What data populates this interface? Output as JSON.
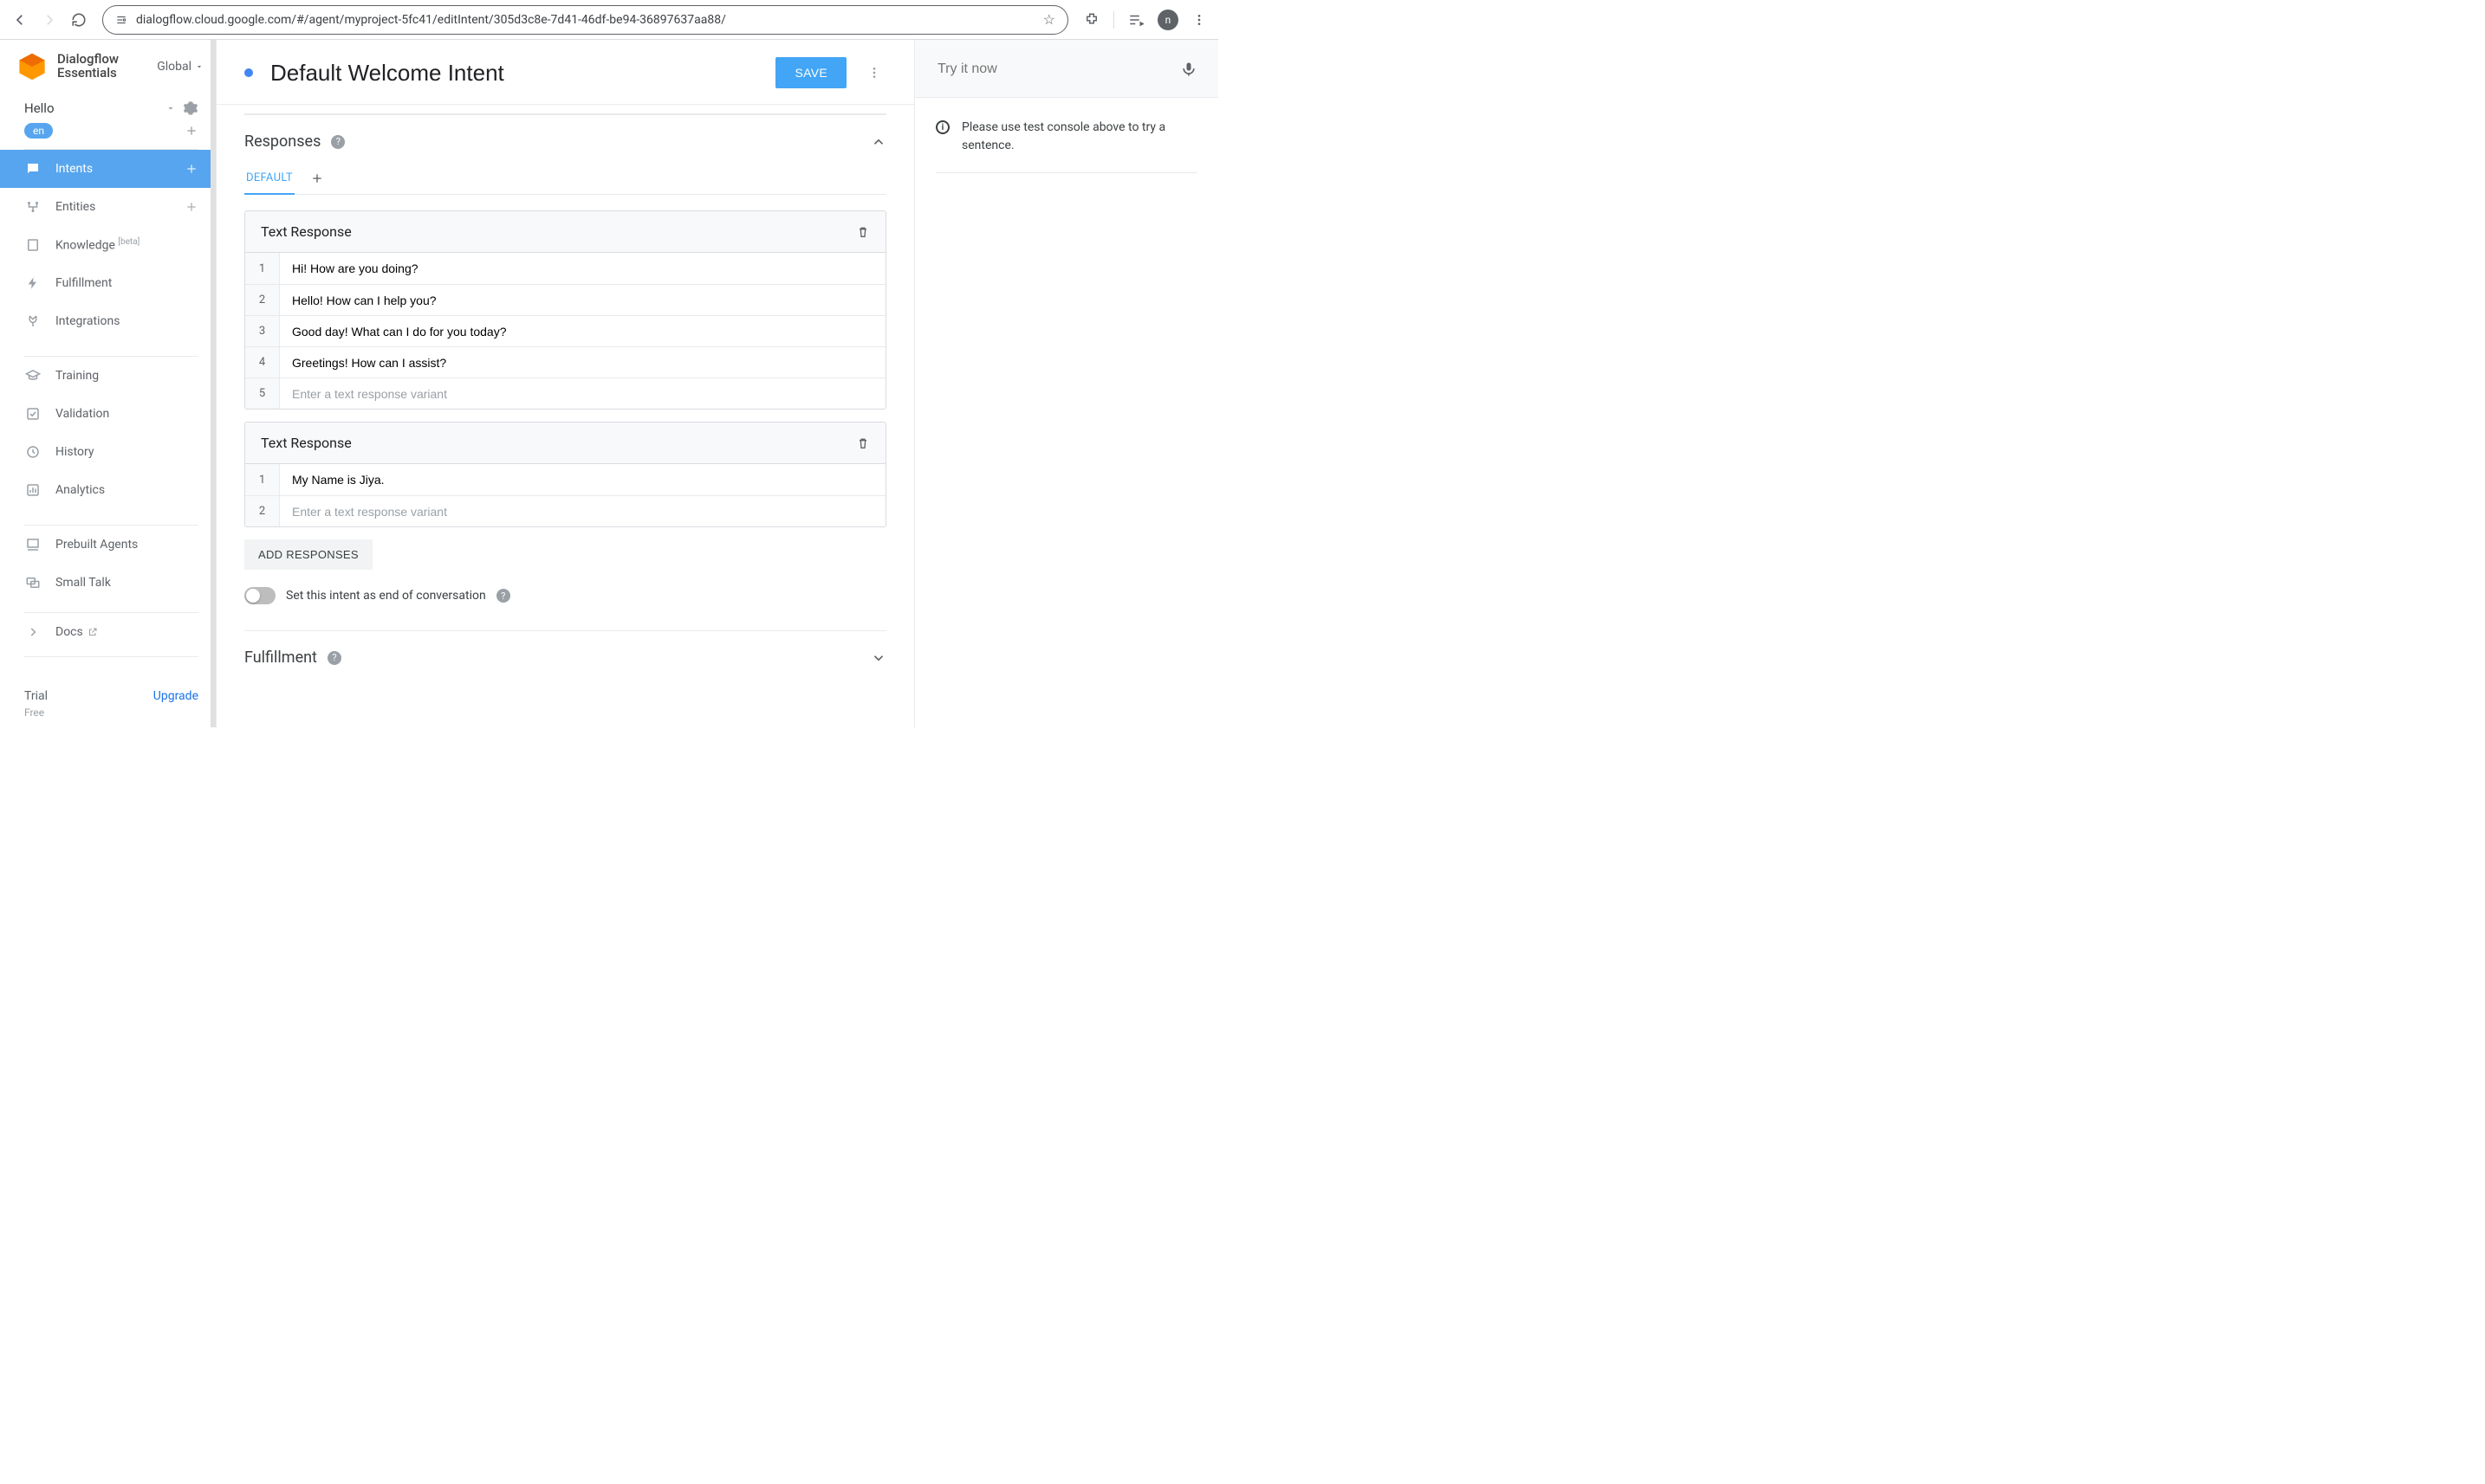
{
  "browser": {
    "url": "dialogflow.cloud.google.com/#/agent/myproject-5fc41/editIntent/305d3c8e-7d41-46df-be94-36897637aa88/",
    "avatar_initial": "n"
  },
  "brand": {
    "line1": "Dialogflow",
    "line2": "Essentials",
    "region": "Global"
  },
  "agent": {
    "name": "Hello",
    "lang_chip": "en"
  },
  "nav": {
    "intents": "Intents",
    "entities": "Entities",
    "knowledge": "Knowledge",
    "knowledge_badge": "[beta]",
    "fulfillment": "Fulfillment",
    "integrations": "Integrations",
    "training": "Training",
    "validation": "Validation",
    "history": "History",
    "analytics": "Analytics",
    "prebuilt": "Prebuilt Agents",
    "smalltalk": "Small Talk",
    "docs": "Docs"
  },
  "trial": {
    "label": "Trial",
    "sub": "Free",
    "upgrade": "Upgrade"
  },
  "intent": {
    "title": "Default Welcome Intent",
    "save": "SAVE"
  },
  "responses": {
    "section_title": "Responses",
    "tab_default": "DEFAULT",
    "card_title": "Text Response",
    "card1": [
      "Hi! How are you doing?",
      "Hello! How can I help you?",
      "Good day! What can I do for you today?",
      "Greetings! How can I assist?"
    ],
    "card2": [
      "My Name is Jiya."
    ],
    "placeholder": "Enter a text response variant",
    "add_btn": "ADD RESPONSES",
    "eoc_label": "Set this intent as end of conversation"
  },
  "fulfillment_section": {
    "title": "Fulfillment"
  },
  "tryit": {
    "placeholder": "Try it now",
    "tip": "Please use test console above to try a sentence."
  }
}
